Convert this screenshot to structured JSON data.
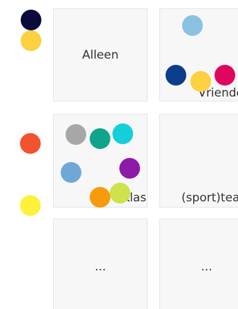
{
  "columns": {
    "a": {
      "top": {
        "label": "Alleen",
        "dots": [
          {
            "color": "#0b0b3b",
            "icon": "avatar-dot"
          },
          {
            "color": "#fcd13f",
            "icon": "avatar-dot"
          }
        ]
      },
      "middle": {
        "label": "Klas",
        "dots": [
          {
            "color": "#f2532f"
          },
          {
            "color": "#a7a7a7"
          },
          {
            "color": "#10a58a"
          },
          {
            "color": "#14cfd9"
          },
          {
            "color": "#6fa8d6"
          },
          {
            "color": "#8e1aa8"
          },
          {
            "color": "#cde24b"
          },
          {
            "color": "#f79b0e"
          }
        ]
      },
      "bottom": {
        "label": "..."
      }
    },
    "b": {
      "top": {
        "label": "Vrienden",
        "dots": [
          {
            "color": "#8ac1e3"
          },
          {
            "color": "#0a3d8a"
          },
          {
            "color": "#fcd13f"
          },
          {
            "color": "#e0065d"
          }
        ]
      },
      "middle": {
        "label": "(sport)team"
      },
      "bottom": {
        "label": "..."
      }
    }
  },
  "side": {
    "yellow": {
      "color": "#fdf13a"
    }
  }
}
